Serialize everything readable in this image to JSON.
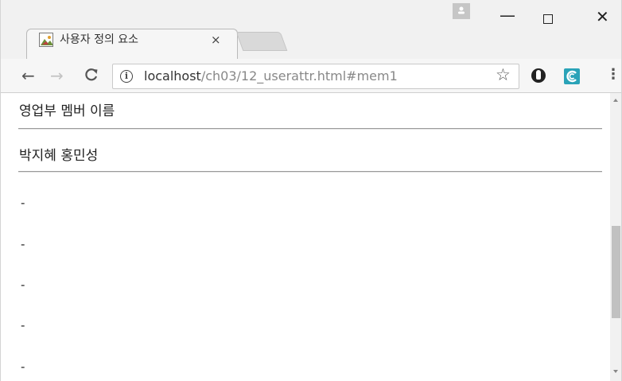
{
  "tab": {
    "title": "사용자 정의 요소",
    "close_glyph": "×"
  },
  "window_controls": {
    "minimize": "—",
    "close": "✕"
  },
  "toolbar": {
    "back_glyph": "←",
    "forward_glyph": "→",
    "reload_glyph": "C",
    "info_glyph": "i",
    "url_host": "localhost",
    "url_path": "/ch03/12_userattr.html#mem1",
    "star_glyph": "☆",
    "menu_glyph": "⋮"
  },
  "icons": {
    "favicon": "image-favicon-icon",
    "extension1": "extension-icon",
    "extension2": "extension-icon",
    "profile": "profile-icon"
  },
  "content": {
    "heading": "영업부 멤버 이름",
    "names": "박지혜 홍민성",
    "items": [
      "-",
      "-",
      "-",
      "-",
      "-"
    ]
  }
}
